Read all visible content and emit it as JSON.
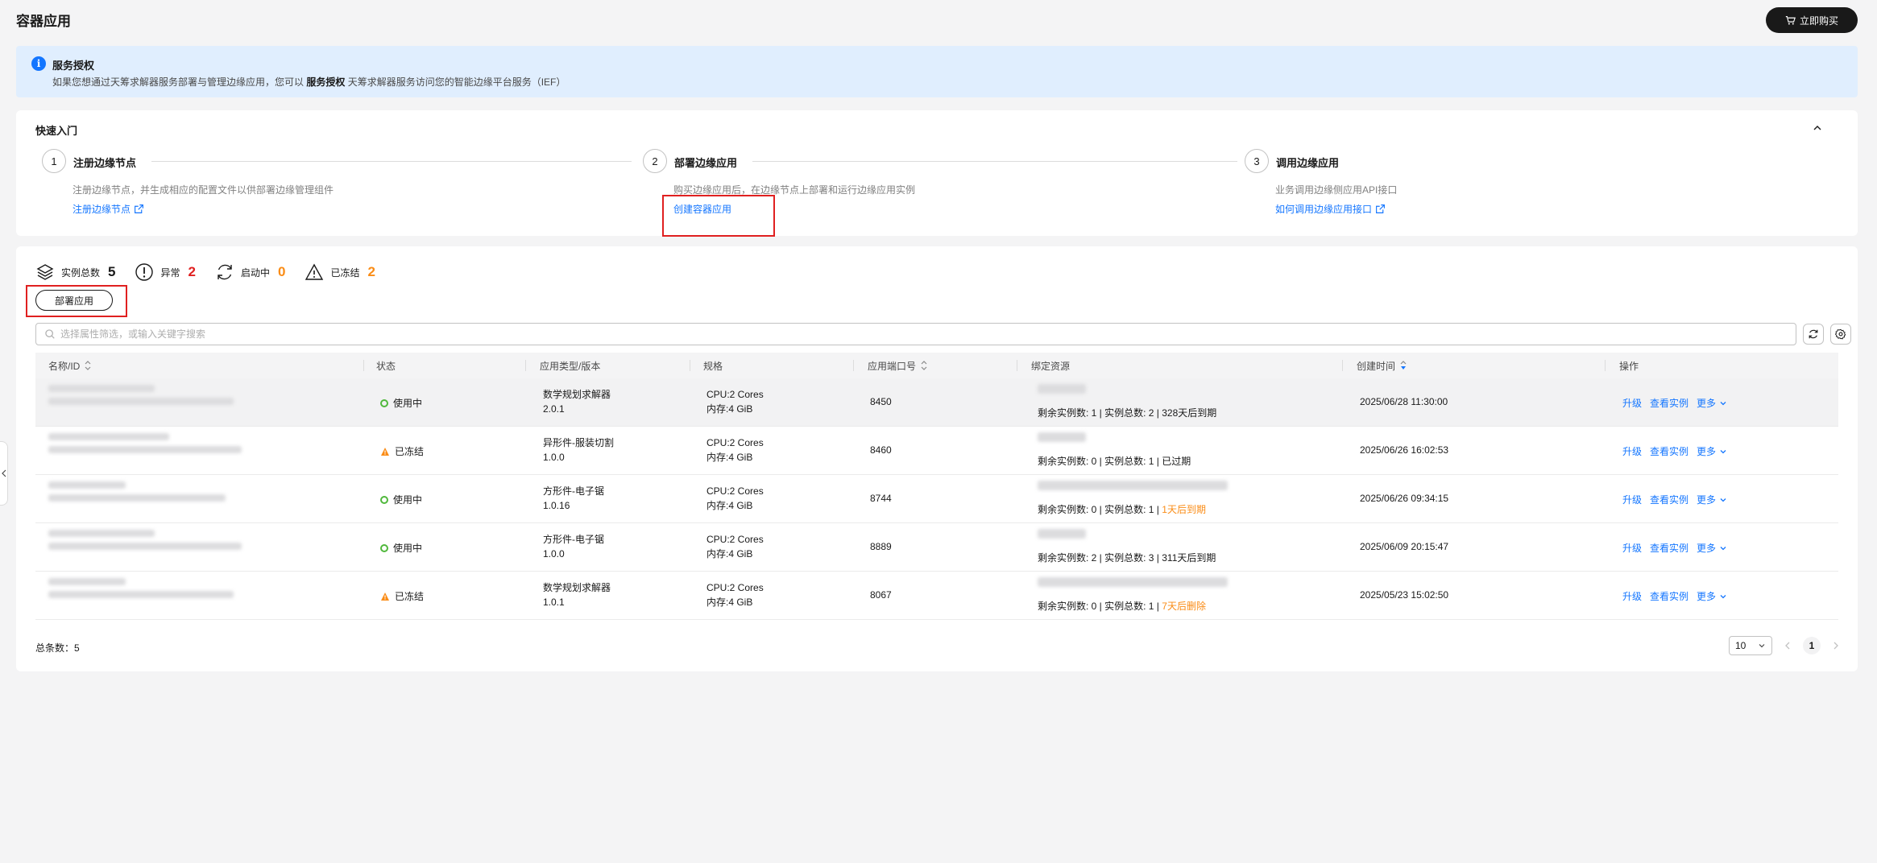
{
  "header": {
    "title": "容器应用",
    "buy_label": "立即购买"
  },
  "banner": {
    "title": "服务授权",
    "text_before": "如果您想通过天筹求解器服务部署与管理边缘应用，您可以 ",
    "text_bold": "服务授权",
    "text_after": " 天筹求解器服务访问您的智能边缘平台服务（IEF）"
  },
  "quick_start": {
    "title": "快速入门",
    "steps": [
      {
        "num": "1",
        "title": "注册边缘节点",
        "desc": "注册边缘节点，并生成相应的配置文件以供部署边缘管理组件",
        "link": "注册边缘节点"
      },
      {
        "num": "2",
        "title": "部署边缘应用",
        "desc": "购买边缘应用后，在边缘节点上部署和运行边缘应用实例",
        "link": "创建容器应用"
      },
      {
        "num": "3",
        "title": "调用边缘应用",
        "desc": "业务调用边缘侧应用API接口",
        "link": "如何调用边缘应用接口"
      }
    ]
  },
  "stats": {
    "total_label": "实例总数",
    "total": "5",
    "abnormal_label": "异常",
    "abnormal": "2",
    "starting_label": "启动中",
    "starting": "0",
    "frozen_label": "已冻结",
    "frozen": "2"
  },
  "toolbar": {
    "deploy_label": "部署应用",
    "search_placeholder": "选择属性筛选，或输入关键字搜索"
  },
  "table": {
    "columns": [
      "名称/ID",
      "状态",
      "应用类型/版本",
      "规格",
      "应用端口号",
      "绑定资源",
      "创建时间",
      "操作"
    ],
    "rows": [
      {
        "status": "使用中",
        "status_type": "running",
        "app_type": "数学规划求解器",
        "version": "2.0.1",
        "cpu": "CPU:2 Cores",
        "mem": "内存:4 GiB",
        "port": "8450",
        "res_text": "剩余实例数: 1 | 实例总数: 2 | 328天后到期",
        "res_suffix": "",
        "created": "2025/06/28 11:30:00"
      },
      {
        "status": "已冻结",
        "status_type": "frozen",
        "app_type": "异形件-服装切割",
        "version": "1.0.0",
        "cpu": "CPU:2 Cores",
        "mem": "内存:4 GiB",
        "port": "8460",
        "res_text": "剩余实例数: 0 | 实例总数: 1 | 已过期",
        "res_suffix": "",
        "created": "2025/06/26 16:02:53"
      },
      {
        "status": "使用中",
        "status_type": "running",
        "app_type": "方形件-电子锯",
        "version": "1.0.16",
        "cpu": "CPU:2 Cores",
        "mem": "内存:4 GiB",
        "port": "8744",
        "res_text": "剩余实例数: 0 | 实例总数: 1 | ",
        "res_suffix": "1天后到期",
        "created": "2025/06/26 09:34:15"
      },
      {
        "status": "使用中",
        "status_type": "running",
        "app_type": "方形件-电子锯",
        "version": "1.0.0",
        "cpu": "CPU:2 Cores",
        "mem": "内存:4 GiB",
        "port": "8889",
        "res_text": "剩余实例数: 2 | 实例总数: 3 | 311天后到期",
        "res_suffix": "",
        "created": "2025/06/09 20:15:47"
      },
      {
        "status": "已冻结",
        "status_type": "frozen",
        "app_type": "数学规划求解器",
        "version": "1.0.1",
        "cpu": "CPU:2 Cores",
        "mem": "内存:4 GiB",
        "port": "8067",
        "res_text": "剩余实例数: 0 | 实例总数: 1 | ",
        "res_suffix": "7天后删除",
        "created": "2025/05/23 15:02:50"
      }
    ],
    "ops": {
      "upgrade": "升级",
      "view": "查看实例",
      "more": "更多"
    }
  },
  "footer": {
    "total_label": "总条数：5",
    "page_size": "10",
    "current_page": "1"
  },
  "colors": {
    "primary": "#1476ff",
    "running": "#50b83c",
    "frozen": "#fa8c16",
    "danger": "#e02020",
    "highlight_box": "#e02020"
  }
}
